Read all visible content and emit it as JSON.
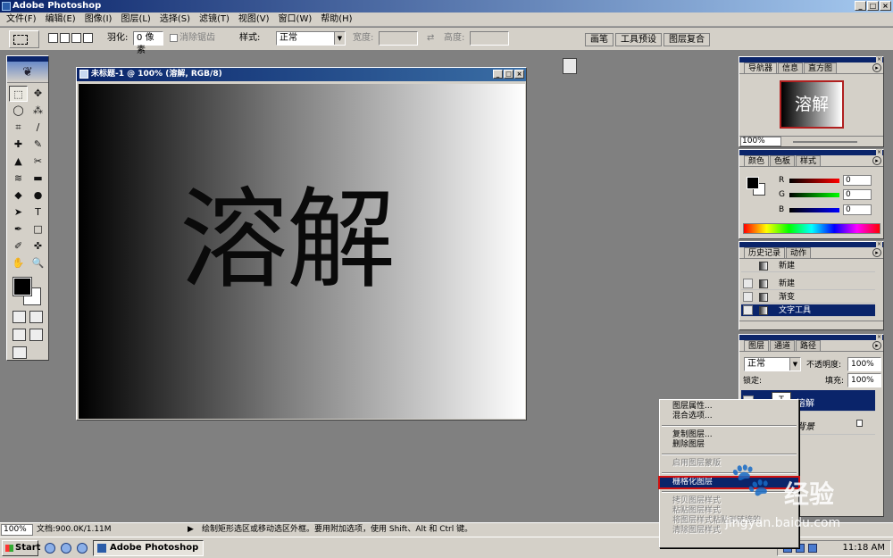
{
  "app": {
    "title": "Adobe Photoshop"
  },
  "window_controls": {
    "min": "_",
    "max": "□",
    "close": "×"
  },
  "menu": [
    "文件(F)",
    "编辑(E)",
    "图像(I)",
    "图层(L)",
    "选择(S)",
    "滤镜(T)",
    "视图(V)",
    "窗口(W)",
    "帮助(H)"
  ],
  "options": {
    "feather_label": "羽化:",
    "feather_value": "0 像素",
    "antialias_label": "消除锯齿",
    "style_label": "样式:",
    "style_value": "正常",
    "width_label": "宽度:",
    "swap_glyph": "⇄",
    "height_label": "高度:",
    "palette_tabs": [
      "画笔",
      "工具预设",
      "图层复合"
    ]
  },
  "tools": [
    "⬚",
    "✥",
    "◯",
    "⁂",
    "⌗",
    "∕",
    "✚",
    "✎",
    "▲",
    "✂",
    "≋",
    "▬",
    "◆",
    "●",
    "➤",
    "T",
    "✒",
    "□",
    "✐",
    "✜",
    "✋",
    "🔍"
  ],
  "toolbox": {
    "logo_glyph": "❦"
  },
  "document": {
    "title": "未标题-1 @ 100% (溶解, RGB/8)",
    "canvas_text": "溶解"
  },
  "navigator": {
    "tabs": [
      "导航器",
      "信息",
      "直方图"
    ],
    "thumb_text": "溶解",
    "zoom": "100%"
  },
  "color": {
    "tabs": [
      "颜色",
      "色板",
      "样式"
    ],
    "channels": [
      {
        "label": "R",
        "value": "0",
        "gradient": "linear-gradient(90deg,#000,#f00)"
      },
      {
        "label": "G",
        "value": "0",
        "gradient": "linear-gradient(90deg,#000,#0f0)"
      },
      {
        "label": "B",
        "value": "0",
        "gradient": "linear-gradient(90deg,#000,#00f)"
      }
    ]
  },
  "history": {
    "tabs": [
      "历史记录",
      "动作"
    ],
    "snapshot": "新建",
    "items": [
      "新建",
      "渐变",
      "文字工具"
    ]
  },
  "layers": {
    "tabs": [
      "图层",
      "通道",
      "路径"
    ],
    "blend_mode": "正常",
    "opacity_label": "不透明度:",
    "opacity_value": "100%",
    "lock_label": "锁定:",
    "fill_label": "填充:",
    "fill_value": "100%",
    "items": [
      {
        "thumb": "T",
        "name": "溶解"
      },
      {
        "thumb": "",
        "name": "背景"
      }
    ]
  },
  "context_menu": {
    "items": [
      "图层属性...",
      "混合选项...",
      "复制图层...",
      "删除图层",
      "启用图层蒙版",
      "栅格化图层",
      "拷贝图层样式",
      "粘贴图层样式",
      "将图层样式粘贴到链接的",
      "清除图层样式"
    ]
  },
  "status": {
    "zoom": "100%",
    "doc": "文档:900.0K/1.11M",
    "arrow": "▶",
    "hint": "绘制矩形选区或移动选区外框。要用附加选项，使用 Shift、Alt 和 Ctrl 键。"
  },
  "taskbar": {
    "start": "Start",
    "task": "Adobe Photoshop",
    "clock": "11:18 AM"
  },
  "watermark": {
    "paw": "🐾",
    "text": "经验",
    "url": "jingyan.baidu.com"
  }
}
